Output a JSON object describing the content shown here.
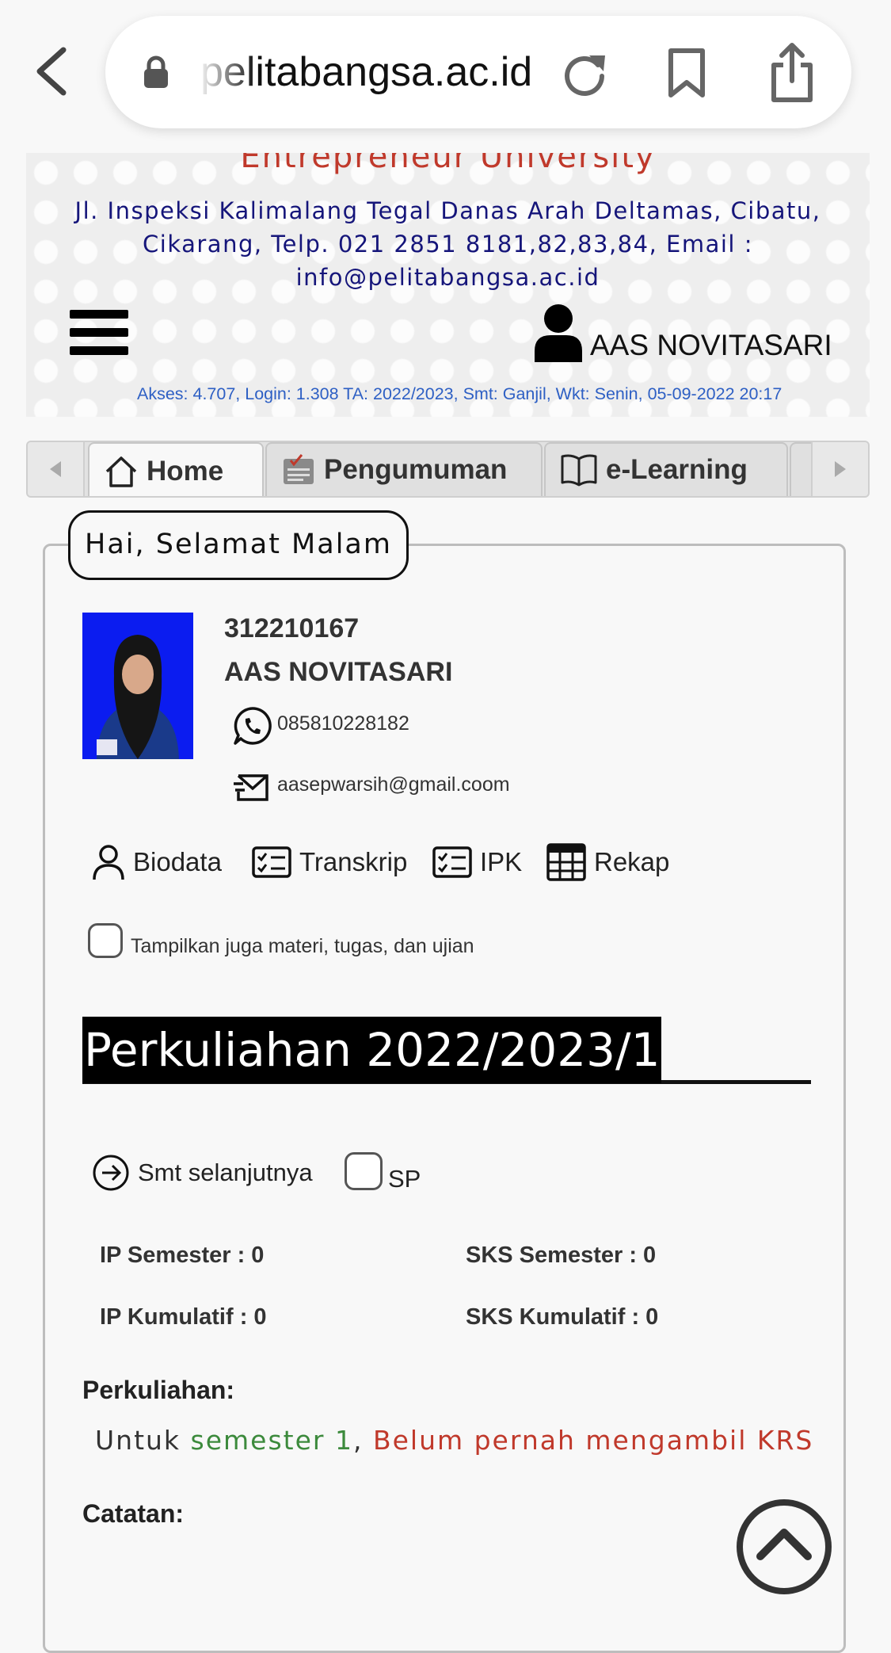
{
  "browser": {
    "url": "pelitabangsa.ac.id"
  },
  "header": {
    "university_name": "Entrepreneur University",
    "address": "Jl. Inspeksi Kalimalang Tegal Danas Arah Deltamas, Cibatu, Cikarang, Telp. 021 2851 8181,82,83,84, Email : info@pelitabangsa.ac.id",
    "user_name": "AAS NOVITASARI",
    "access_info": "Akses: 4.707, Login: 1.308 TA: 2022/2023, Smt: Ganjil, Wkt: Senin, 05-09-2022 20:17"
  },
  "tabs": [
    {
      "label": "Home",
      "icon": "home-icon",
      "active": true
    },
    {
      "label": "Pengumuman",
      "icon": "announcement-icon",
      "active": false
    },
    {
      "label": "e-Learning",
      "icon": "book-icon",
      "active": false
    }
  ],
  "greeting": "Hai, Selamat Malam",
  "profile": {
    "nim": "312210167",
    "name": "AAS NOVITASARI",
    "phone": "085810228182",
    "email": "aasepwarsih@gmail.coom"
  },
  "links": {
    "biodata": "Biodata",
    "transkrip": "Transkrip",
    "ipk": "IPK",
    "rekap": "Rekap"
  },
  "show_materials_label": "Tampilkan juga materi, tugas, dan ujian",
  "period": {
    "title": "Perkuliahan 2022/2023/1",
    "next_semester_label": "Smt selanjutnya",
    "sp_label": "SP"
  },
  "stats": {
    "ip_semester": "IP Semester : 0",
    "sks_semester": "SKS Semester : 0",
    "ip_kumulatif": "IP Kumulatif : 0",
    "sks_kumulatif": "SKS Kumulatif : 0"
  },
  "perkuliahan": {
    "title": "Perkuliahan:",
    "prefix": "Untuk ",
    "semester": "semester 1",
    "separator": ", ",
    "message": "Belum pernah mengambil KRS"
  },
  "catatan_title": "Catatan:",
  "colors": {
    "brand_red": "#c0392b",
    "header_blue": "#15157a",
    "info_blue": "#2d5fc4",
    "semester_green": "#3c8a3c"
  }
}
